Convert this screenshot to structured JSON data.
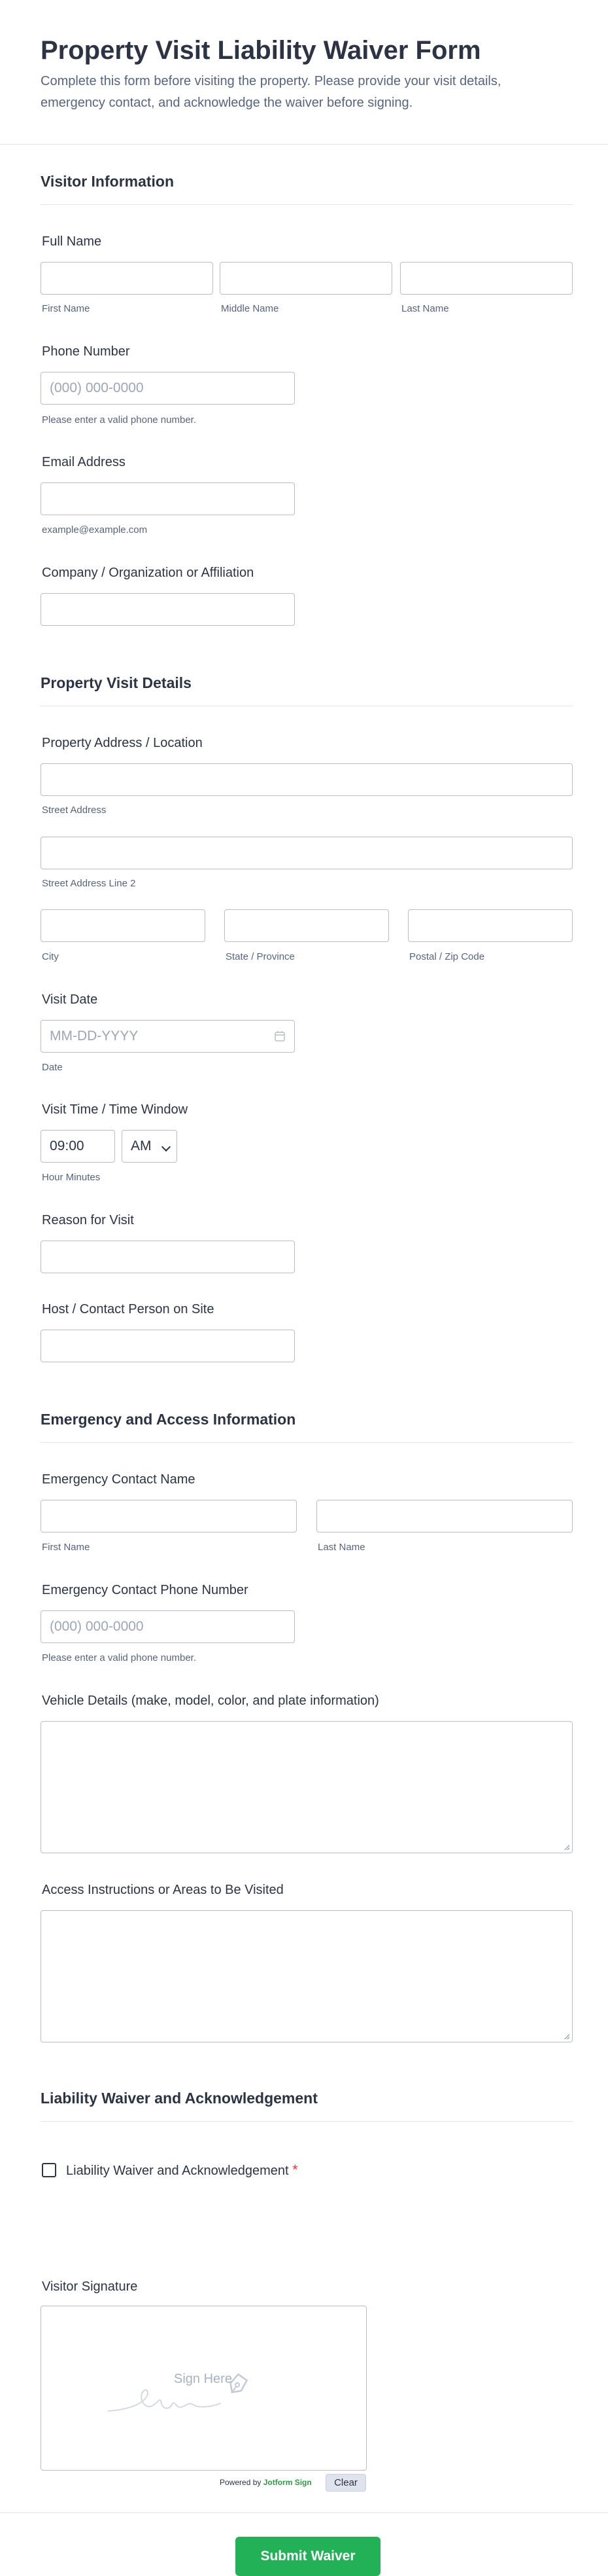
{
  "header": {
    "title": "Property Visit Liability Waiver Form",
    "subtitle": "Complete this form before visiting the property. Please provide your visit details, emergency contact, and acknowledge the waiver before signing."
  },
  "visitor": {
    "section_title": "Visitor Information",
    "full_name": {
      "label": "Full Name",
      "first": "First Name",
      "middle": "Middle Name",
      "last": "Last Name"
    },
    "phone": {
      "label": "Phone Number",
      "placeholder": "(000) 000-0000",
      "hint": "Please enter a valid phone number."
    },
    "email": {
      "label": "Email Address",
      "hint": "example@example.com"
    },
    "company": {
      "label": "Company / Organization or Affiliation"
    }
  },
  "property": {
    "section_title": "Property Visit Details",
    "address": {
      "label": "Property Address / Location",
      "street": "Street Address",
      "street2": "Street Address Line 2",
      "city": "City",
      "state": "State / Province",
      "zip": "Postal / Zip Code"
    },
    "visit_date": {
      "label": "Visit Date",
      "placeholder": "MM-DD-YYYY",
      "hint": "Date"
    },
    "visit_time": {
      "label": "Visit Time / Time Window",
      "time_value": "09:00",
      "ampm_value": "AM",
      "hint": "Hour Minutes"
    },
    "reason": {
      "label": "Reason for Visit"
    },
    "host": {
      "label": "Host / Contact Person on Site"
    }
  },
  "emergency": {
    "section_title": "Emergency and Access Information",
    "contact_name": {
      "label": "Emergency Contact Name",
      "first": "First Name",
      "last": "Last Name"
    },
    "contact_phone": {
      "label": "Emergency Contact Phone Number",
      "placeholder": "(000) 000-0000",
      "hint": "Please enter a valid phone number."
    },
    "vehicle": {
      "label": "Vehicle Details (make, model, color, and plate information)"
    },
    "access": {
      "label": "Access Instructions or Areas to Be Visited"
    }
  },
  "waiver": {
    "section_title": "Liability Waiver and Acknowledgement",
    "checkbox_label": "Liability Waiver and Acknowledgement",
    "required_mark": "*",
    "signature_label": "Visitor Signature",
    "sign_here": "Sign Here",
    "powered_by": "Powered by",
    "powered_brand": "Jotform Sign",
    "clear_label": "Clear"
  },
  "submit": {
    "label": "Submit Waiver"
  },
  "colors": {
    "accent": "#22b157",
    "text": "#2c3345",
    "muted": "#57647e",
    "border": "#b8bdc9",
    "required": "#f23a3c"
  }
}
